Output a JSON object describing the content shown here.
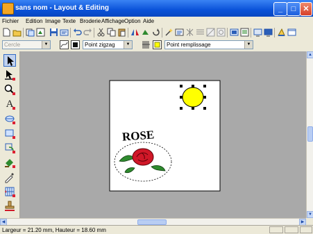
{
  "window": {
    "title": "sans nom - Layout & Editing"
  },
  "menu": [
    "Fichier",
    "Edition",
    "Image",
    "Texte",
    "Broderie",
    "Affichage",
    "Option",
    "Aide"
  ],
  "toolbar2": {
    "shape_select": "Cercle",
    "stitch_select": "Point zigzag",
    "fill_select": "Point remplissage"
  },
  "canvas": {
    "text": "ROSE"
  },
  "status": {
    "text": "Largeur = 21.20 mm, Hauteur = 18.60 mm"
  },
  "colors": {
    "accent": "#0a52d8",
    "circle_fill": "#ffff00",
    "rose_red": "#d01828",
    "leaf_green": "#2e8a2e"
  }
}
